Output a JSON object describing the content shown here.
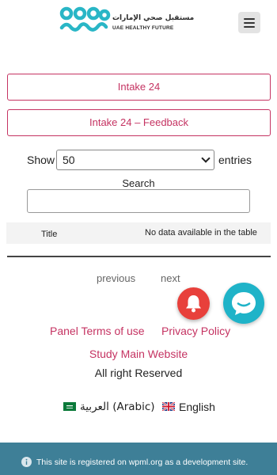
{
  "header": {
    "logo_ar": "مستقبل صحي الإمارات",
    "logo_en": "UAE HEALTHY FUTURE",
    "brand_color": "#29b6c6"
  },
  "actions": {
    "intake_label": "Intake 24",
    "feedback_label": "Intake 24 – Feedback",
    "accent_color": "#c53362"
  },
  "table_controls": {
    "show_label": "Show",
    "entries_selected": "50",
    "entries_label": "entries",
    "search_label": "Search",
    "search_value": ""
  },
  "table": {
    "columns": [
      "Title"
    ],
    "empty_message": "No data available in the table"
  },
  "pagination": {
    "previous_label": "previous",
    "next_label": "next"
  },
  "floating": {
    "bell_icon": "bell-icon",
    "chat_icon": "chat-bubble-icon"
  },
  "footer": {
    "terms_label": "Panel Terms of use",
    "privacy_label": "Privacy Policy",
    "study_label": "Study Main Website",
    "rights_text": "All right Reserved",
    "lang_arabic": "العربية (Arabic)",
    "lang_english": "English"
  },
  "notice": {
    "text": "This site is registered on wpml.org as a development site."
  }
}
